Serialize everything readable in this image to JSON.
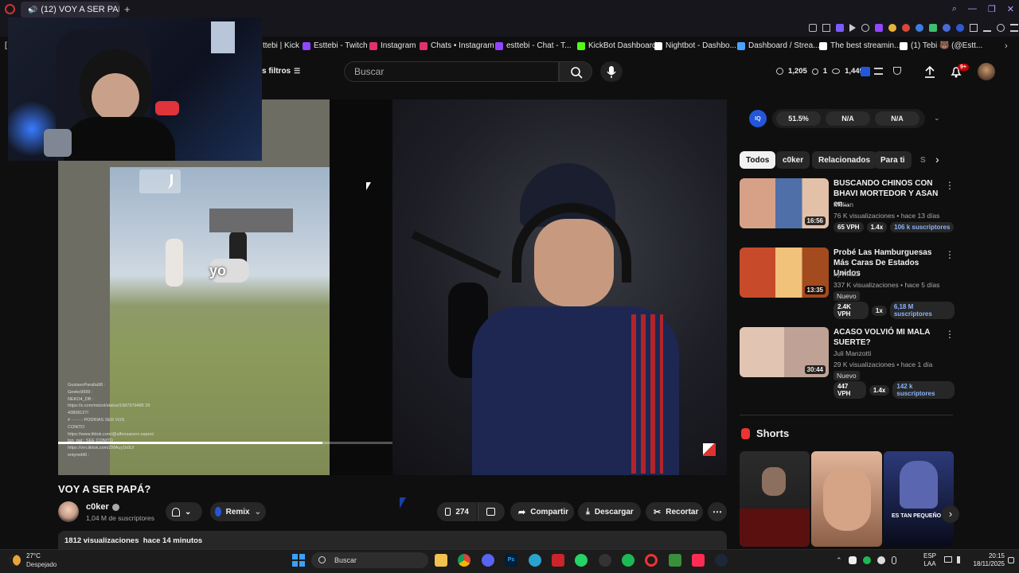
{
  "browser": {
    "tab_title": "(12) VOY A SER PAPÁ?",
    "new_tab": "+",
    "bookmarks": [
      {
        "label": "ttebi | Kick",
        "color": "#53fc18"
      },
      {
        "label": "Esttebi - Twitch",
        "color": "#9146ff"
      },
      {
        "label": "Instagram",
        "color": "#e1306c"
      },
      {
        "label": "Chats • Instagram",
        "color": "#e1306c"
      },
      {
        "label": "esttebi - Chat - T...",
        "color": "#9146ff"
      },
      {
        "label": "KickBot Dashboard",
        "color": "#53fc18"
      },
      {
        "label": "Nightbot - Dashbo...",
        "color": "#ffffff"
      },
      {
        "label": "Dashboard / Strea...",
        "color": "#4aa3ff"
      },
      {
        "label": "The best streamin...",
        "color": "#ffffff"
      },
      {
        "label": "(1) Tebi 🐻 (@Estt...",
        "color": "#ffffff"
      }
    ]
  },
  "youtube": {
    "filters_label": "s filtros",
    "search_placeholder": "Buscar",
    "stats": {
      "likes": "1,205",
      "dislikes": "1",
      "views": "1,449"
    },
    "notif_badge": "9+"
  },
  "player": {
    "tiktok_text": "yo",
    "progress": 0.79,
    "chat_lines": [
      "GustavoParalta98 :",
      "Geeko9999 :",
      "NEKO4_DB :",
      "https://x.com/mdzol/status/1987979485 29",
      "43808127l",
      "# ·······: PODRIAS SER VOS",
      "CONITO",
      "https://www.tiktok.com/@alfonsanero.sapeo/",
      "tgn_pat : SEE CONITO",
      "https://vm.tiktok.com/ZMAuy1k0U/",
      "entyredit0 :"
    ]
  },
  "video": {
    "title": "VOY A SER PAPÁ?",
    "channel": "c0ker",
    "subscribers": "1,04 M de suscriptores",
    "remix": "Remix",
    "likes": "274",
    "share": "Compartir",
    "download": "Descargar",
    "clip": "Recortar",
    "views_line": "1812 visualizaciones  hace 14 minutos"
  },
  "sidebar": {
    "iq_label": "IQ",
    "metrics": [
      "51.5%",
      "N/A",
      "N/A"
    ],
    "chips": [
      "Todos",
      "c0ker",
      "Relacionados",
      "Para ti",
      "S"
    ],
    "videos": [
      {
        "title": "BUSCANDO CHINOS CON BHAVI MORTEDOR Y ASAN en...",
        "channel": "Melian",
        "meta": "76 K visualizaciones • hace 13 días",
        "duration": "16:56",
        "vph": "65 VPH",
        "ratio": "1.4x",
        "subs": "106 k suscriptores",
        "badge": ""
      },
      {
        "title": "Probé Las Hamburguesas Más Caras De Estados Unidos",
        "channel": "byViruZz",
        "meta": "337 K visualizaciones • hace 5 días",
        "duration": "13:35",
        "vph": "2.4K VPH",
        "ratio": "1x",
        "subs": "6,18 M suscriptores",
        "badge": "Nuevo"
      },
      {
        "title": "ACASO VOLVIÓ MI MALA SUERTE?",
        "channel": "Juli Manzotti",
        "meta": "29 K visualizaciones • hace 1 día",
        "duration": "30:44",
        "vph": "447 VPH",
        "ratio": "1.4x",
        "subs": "142 k suscriptores",
        "badge": "Nuevo"
      }
    ],
    "shorts_title": "Shorts",
    "shorts_caption": "ES TAN PEQUEÑO"
  },
  "taskbar": {
    "weather_temp": "27°C",
    "weather_desc": "Despejado",
    "search": "Buscar",
    "lang": "ESP",
    "lang2": "LAA",
    "time": "20:15",
    "date": "18/11/2025"
  }
}
